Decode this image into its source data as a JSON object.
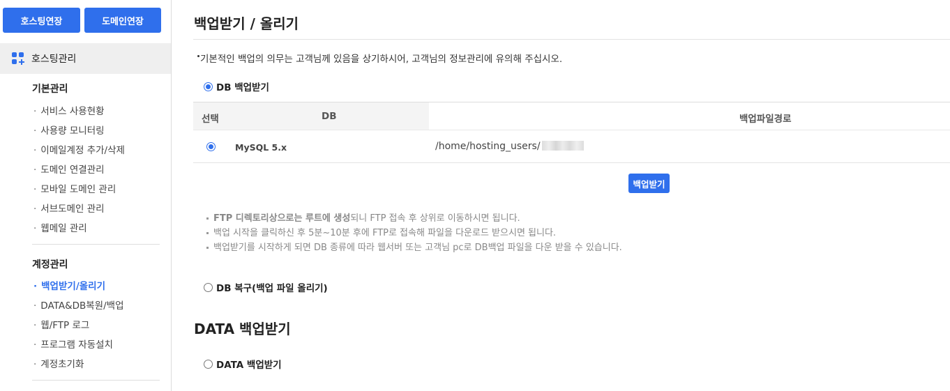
{
  "sidebar": {
    "top_buttons": [
      "호스팅연장",
      "도메인연장"
    ],
    "section_label": "호스팅관리",
    "groups": [
      {
        "title": "기본관리",
        "items": [
          "서비스 사용현황",
          "사용량 모니터링",
          "이메일계정 추가/삭제",
          "도메인 연결관리",
          "모바일 도메인 관리",
          "서브도메인 관리",
          "웹메일 관리"
        ]
      },
      {
        "title": "계정관리",
        "items": [
          "백업받기/올리기",
          "DATA&DB복원/백업",
          "웹/FTP 로그",
          "프로그램 자동설치",
          "계정초기화"
        ]
      }
    ],
    "bullet": "·"
  },
  "main": {
    "title": "백업받기 / 올리기",
    "notice": "기본적인 백업의 의무는 고객님께 있음을 상기하시어, 고객님의 정보관리에 유의해 주십시오.",
    "db_backup_option": "DB 백업받기",
    "table": {
      "headers": [
        "선택",
        "DB",
        "백업파일경로"
      ],
      "rows": [
        {
          "db": "MySQL 5.x",
          "path": "/home/hosting_users/"
        }
      ]
    },
    "backup_button": "백업받기",
    "notes": [
      {
        "bold": "FTP 디렉토리상으로는 루트에 생성",
        "text": "되니 FTP 접속 후 상위로 이동하시면 됩니다."
      },
      {
        "bold": "",
        "text": "백업 시작을 클릭하신 후 5분~10분 후에 FTP로 접속해 파일을 다운로드 받으시면 됩니다."
      },
      {
        "bold": "",
        "text": "백업받기를 시작하게 되면 DB 종류에 따라 웹서버 또는 고객님 pc로 DB백업 파일을 다운 받을 수 있습니다."
      }
    ],
    "db_restore_option": "DB 복구(백업 파일 올리기)",
    "data_section_title": "DATA 백업받기",
    "data_backup_option": "DATA 백업받기"
  },
  "colors": {
    "accent": "#2f6fec",
    "section_bg": "#efefef"
  },
  "icons": {
    "section_icon": "grid-plus-icon",
    "radio": "radio-icon"
  }
}
